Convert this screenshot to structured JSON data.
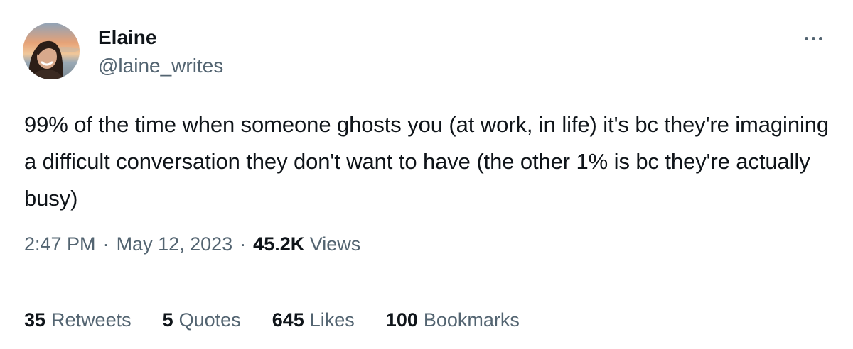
{
  "author": {
    "display_name": "Elaine",
    "handle": "@laine_writes",
    "avatar_icon": "profile-photo"
  },
  "tweet": {
    "text": "99% of the time when someone ghosts you (at work, in life) it's bc they're imagining a difficult conversation they don't want to have (the other 1% is bc they're actually busy)",
    "time": "2:47 PM",
    "separator": "·",
    "date": "May 12, 2023",
    "views_count": "45.2K",
    "views_label": "Views"
  },
  "stats": [
    {
      "count": "35",
      "label": "Retweets"
    },
    {
      "count": "5",
      "label": "Quotes"
    },
    {
      "count": "645",
      "label": "Likes"
    },
    {
      "count": "100",
      "label": "Bookmarks"
    }
  ],
  "colors": {
    "text_primary": "#0f1419",
    "text_secondary": "#536471",
    "divider": "#cfd9de"
  },
  "icons": {
    "more": "more-horizontal-icon"
  }
}
